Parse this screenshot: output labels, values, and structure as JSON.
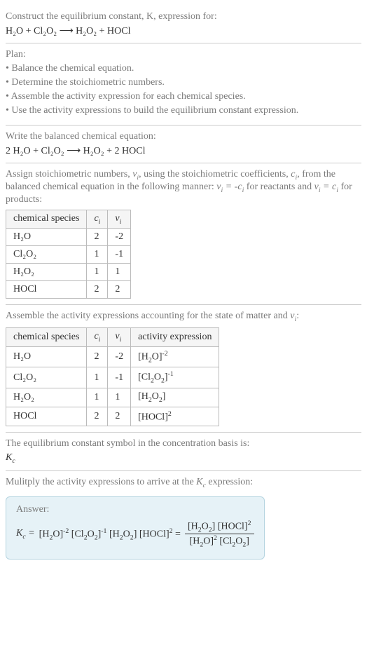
{
  "s1": {
    "prompt": "Construct the equilibrium constant, K, expression for:",
    "equation": "H₂O + Cl₂O₂ ⟶ H₂O₂ + HOCl"
  },
  "s2": {
    "title": "Plan:",
    "b1": "• Balance the chemical equation.",
    "b2": "• Determine the stoichiometric numbers.",
    "b3": "• Assemble the activity expression for each chemical species.",
    "b4": "• Use the activity expressions to build the equilibrium constant expression."
  },
  "s3": {
    "prompt": "Write the balanced chemical equation:",
    "equation": "2 H₂O + Cl₂O₂ ⟶ H₂O₂ + 2 HOCl"
  },
  "s4": {
    "prompt_a": "Assign stoichiometric numbers, ",
    "prompt_b": ", using the stoichiometric coefficients, ",
    "prompt_c": ", from the balanced chemical equation in the following manner: ",
    "prompt_d": " for reactants and ",
    "prompt_e": " for products:",
    "h1": "chemical species",
    "rows": [
      {
        "sp": "H₂O",
        "c": "2",
        "v": "-2"
      },
      {
        "sp": "Cl₂O₂",
        "c": "1",
        "v": "-1"
      },
      {
        "sp": "H₂O₂",
        "c": "1",
        "v": "1"
      },
      {
        "sp": "HOCl",
        "c": "2",
        "v": "2"
      }
    ]
  },
  "s5": {
    "prompt_a": "Assemble the activity expressions accounting for the state of matter and ",
    "prompt_b": ":",
    "h1": "chemical species",
    "h4": "activity expression",
    "rows": [
      {
        "sp": "H₂O",
        "c": "2",
        "v": "-2"
      },
      {
        "sp": "Cl₂O₂",
        "c": "1",
        "v": "-1"
      },
      {
        "sp": "H₂O₂",
        "c": "1",
        "v": "1"
      },
      {
        "sp": "HOCl",
        "c": "2",
        "v": "2"
      }
    ]
  },
  "s6": {
    "prompt": "The equilibrium constant symbol in the concentration basis is:"
  },
  "s7": {
    "prompt_a": "Mulitply the activity expressions to arrive at the ",
    "prompt_b": " expression:",
    "answer": "Answer:"
  }
}
